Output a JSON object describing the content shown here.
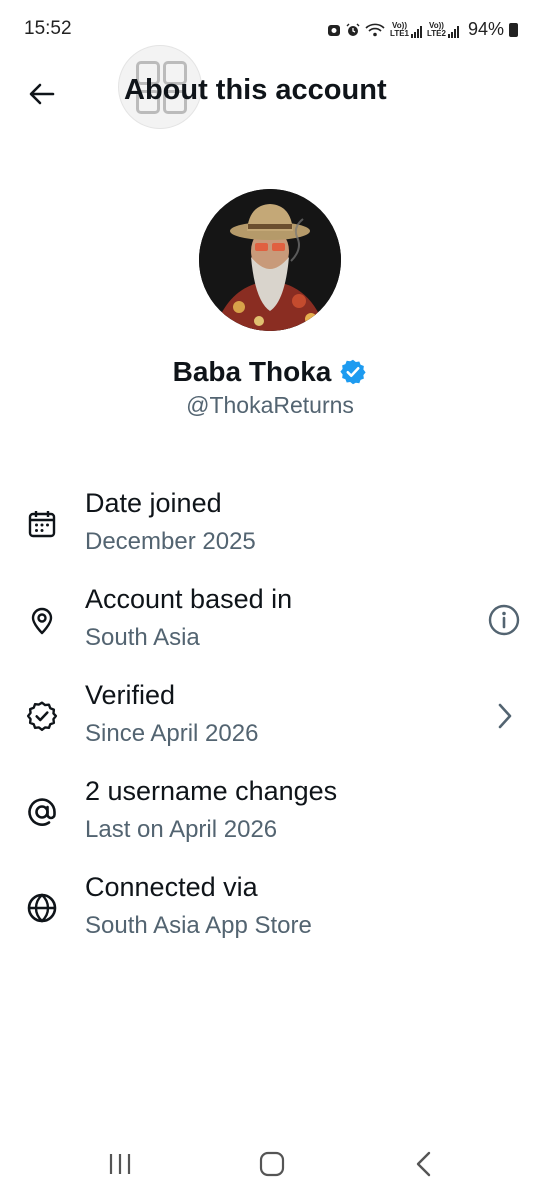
{
  "status_bar": {
    "time": "15:52",
    "battery_percent": "94%",
    "sim1_label": "LTE1",
    "sim2_label": "LTE2",
    "vol_label": "Vo))",
    "icons": [
      "notification-icon",
      "alarm-icon",
      "wifi-icon",
      "signal-icon",
      "battery-icon"
    ]
  },
  "header": {
    "title": "About this account",
    "back_icon": "arrow-left-icon"
  },
  "profile": {
    "display_name": "Baba Thoka",
    "handle": "@ThokaReturns",
    "verified_badge_color": "#1d9bf0"
  },
  "info_items": [
    {
      "title": "Date joined",
      "subtitle": "December 2025",
      "icon": "calendar-icon"
    },
    {
      "title": "Account based in",
      "subtitle": "South Asia",
      "icon": "location-pin-icon",
      "trailing_icon": "info-icon"
    },
    {
      "title": "Verified",
      "subtitle": "Since April 2026",
      "icon": "verified-badge-icon",
      "trailing_icon": "chevron-right-icon"
    },
    {
      "title": "2 username changes",
      "subtitle": "Last on April 2026",
      "icon": "at-sign-icon"
    },
    {
      "title": "Connected via",
      "subtitle": "South Asia App Store",
      "icon": "globe-icon"
    }
  ],
  "nav_bar": {
    "items": [
      "recent-apps-icon",
      "home-icon",
      "back-icon"
    ]
  },
  "colors": {
    "text_primary": "#0f1419",
    "text_secondary": "#536471",
    "accent": "#1d9bf0",
    "background": "#ffffff"
  }
}
